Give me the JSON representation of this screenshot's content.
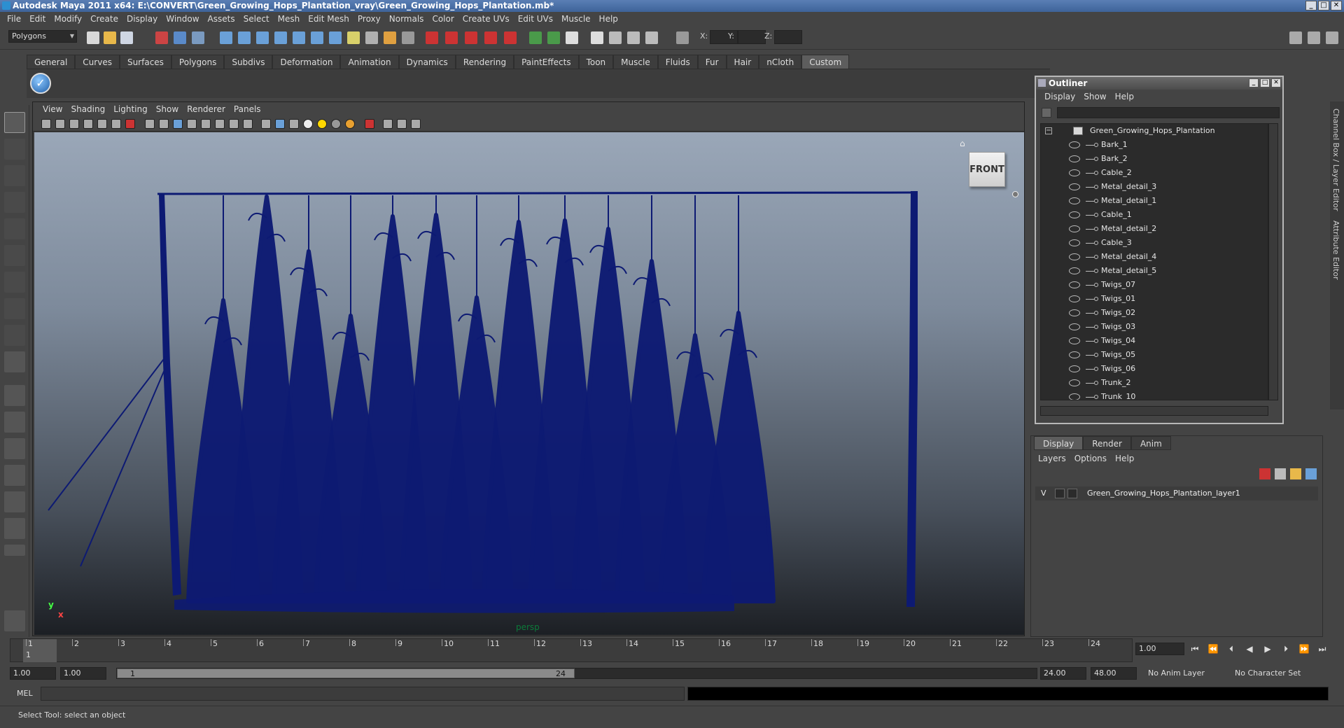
{
  "window": {
    "title": "Autodesk Maya 2011 x64: E:\\CONVERT\\Green_Growing_Hops_Plantation_vray\\Green_Growing_Hops_Plantation.mb*",
    "minimize": "_",
    "maximize": "□",
    "close": "✕"
  },
  "menu": [
    "File",
    "Edit",
    "Modify",
    "Create",
    "Display",
    "Window",
    "Assets",
    "Select",
    "Mesh",
    "Edit Mesh",
    "Proxy",
    "Normals",
    "Color",
    "Create UVs",
    "Edit UVs",
    "Muscle",
    "Help"
  ],
  "toolbar": {
    "mode": "Polygons",
    "x_label": "X:",
    "y_label": "Y:",
    "z_label": "Z:"
  },
  "shelf": {
    "tabs": [
      "General",
      "Curves",
      "Surfaces",
      "Polygons",
      "Subdivs",
      "Deformation",
      "Animation",
      "Dynamics",
      "Rendering",
      "PaintEffects",
      "Toon",
      "Muscle",
      "Fluids",
      "Fur",
      "Hair",
      "nCloth",
      "Custom"
    ],
    "active": "Custom"
  },
  "viewport": {
    "menu": [
      "View",
      "Shading",
      "Lighting",
      "Show",
      "Renderer",
      "Panels"
    ],
    "viewcube": "FRONT",
    "camera": "persp",
    "axis_y": "y",
    "axis_x": "x"
  },
  "outliner": {
    "title": "Outliner",
    "menu": [
      "Display",
      "Show",
      "Help"
    ],
    "root": "Green_Growing_Hops_Plantation",
    "items": [
      "Bark_1",
      "Bark_2",
      "Cable_2",
      "Metal_detail_3",
      "Metal_detail_1",
      "Cable_1",
      "Metal_detail_2",
      "Cable_3",
      "Metal_detail_4",
      "Metal_detail_5",
      "Twigs_07",
      "Twigs_01",
      "Twigs_02",
      "Twigs_03",
      "Twigs_04",
      "Twigs_05",
      "Twigs_06",
      "Trunk_2",
      "Trunk_10"
    ]
  },
  "rightstrip": {
    "channel_box": "Channel Box / Layer Editor",
    "attribute_editor": "Attribute Editor"
  },
  "layers": {
    "tabs": [
      "Display",
      "Render",
      "Anim"
    ],
    "active": "Display",
    "menu": [
      "Layers",
      "Options",
      "Help"
    ],
    "row": {
      "visibility": "V",
      "name": "Green_Growing_Hops_Plantation_layer1"
    }
  },
  "timeslider": {
    "ticks": [
      "1",
      "2",
      "3",
      "4",
      "5",
      "6",
      "7",
      "8",
      "9",
      "10",
      "11",
      "12",
      "13",
      "14",
      "15",
      "16",
      "17",
      "18",
      "19",
      "20",
      "21",
      "22",
      "23",
      "24"
    ],
    "current": "1",
    "frame_field": "1.00"
  },
  "playback": [
    "⏮",
    "⏪",
    "⏴",
    "◀",
    "▶",
    "⏵",
    "⏩",
    "⏭"
  ],
  "range": {
    "start": "1.00",
    "playback_start": "1.00",
    "thumb_start": "1",
    "thumb_end": "24",
    "playback_end": "24.00",
    "end": "48.00",
    "anim_layer": "No Anim Layer",
    "character_set": "No Character Set"
  },
  "cmdline": {
    "label": "MEL"
  },
  "helpline": {
    "text": "Select Tool: select an object"
  },
  "colors": {
    "mesh": "#0d1a73",
    "title_bar": "#4a6fa8",
    "panel_bg": "#444444"
  }
}
